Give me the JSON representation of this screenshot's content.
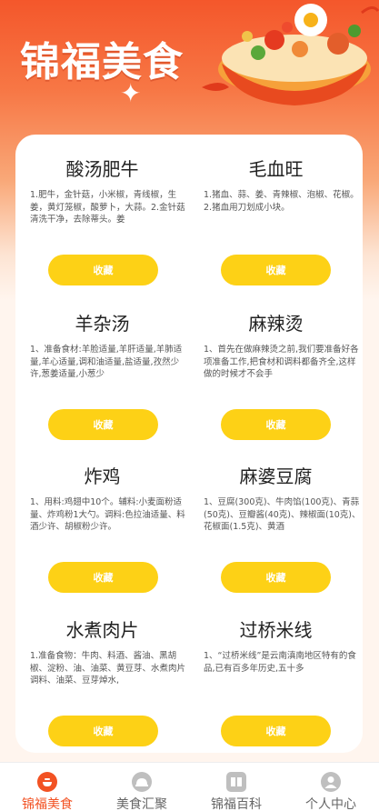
{
  "app": {
    "brand": "锦福美食"
  },
  "recipes": [
    {
      "title": "酸汤肥牛",
      "desc": "1.肥牛，金针菇，小米椒，青线椒，生姜，黄灯笼椒，酸萝卜，大蒜。2.金针菇清洗干净，去除蒂头。姜",
      "button": "收藏"
    },
    {
      "title": "毛血旺",
      "desc": "1.猪血、蒜、姜、青辣椒、泡椒、花椒。2.猪血用刀划成小块。",
      "button": "收藏"
    },
    {
      "title": "羊杂汤",
      "desc": "1、准备食材:羊脸适量,羊肝适量,羊肺适量,羊心适量,调和油适量,盐适量,孜然少许,葱姜适量,小葱少",
      "button": "收藏"
    },
    {
      "title": "麻辣烫",
      "desc": "1、首先在做麻辣烫之前,我们要准备好各项准备工作,把食材和调料都备齐全,这样做的时候才不会手",
      "button": "收藏"
    },
    {
      "title": "炸鸡",
      "desc": "1、用料:鸡翅中10个。辅料:小麦面粉适量、炸鸡粉1大勺。调料:色拉油适量、料酒少许、胡椒粉少许。",
      "button": "收藏"
    },
    {
      "title": "麻婆豆腐",
      "desc": "1、豆腐(300克)、牛肉馅(100克)、青蒜(50克)、豆瓣酱(40克)、辣椒面(10克)、花椒面(1.5克)、黄酒",
      "button": "收藏"
    },
    {
      "title": "水煮肉片",
      "desc": "1.准备食物：牛肉、料酒、酱油、黑胡椒、淀粉、油、油菜、黄豆芽、水煮肉片调料、油菜、豆芽焯水,",
      "button": "收藏"
    },
    {
      "title": "过桥米线",
      "desc": "1、“过桥米线”是云南滇南地区特有的食品,已有百多年历史,五十多",
      "button": "收藏"
    }
  ],
  "tabs": [
    {
      "label": "锦福美食",
      "icon": "bowl-icon",
      "active": true
    },
    {
      "label": "美食汇聚",
      "icon": "dish-cover-icon",
      "active": false
    },
    {
      "label": "锦福百科",
      "icon": "book-icon",
      "active": false
    },
    {
      "label": "个人中心",
      "icon": "user-icon",
      "active": false
    }
  ],
  "colors": {
    "accent": "#f25223",
    "button": "#fdd116",
    "header_top": "#f4572b"
  }
}
